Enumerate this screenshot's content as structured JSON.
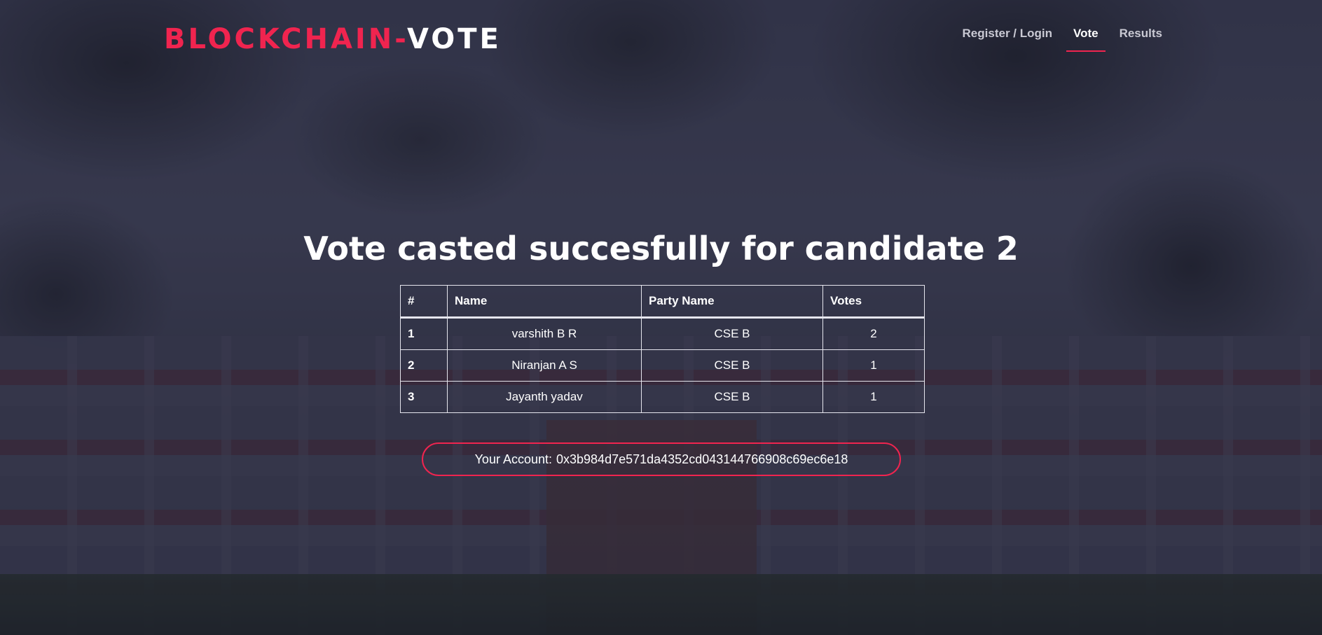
{
  "header": {
    "brand_accent": "BLOCKCHAIN-",
    "brand_rest": "VOTE",
    "nav": [
      {
        "label": "Register / Login",
        "active": false
      },
      {
        "label": "Vote",
        "active": true
      },
      {
        "label": "Results",
        "active": false
      }
    ]
  },
  "main": {
    "headline": "Vote casted succesfully for candidate 2",
    "table": {
      "columns": [
        "#",
        "Name",
        "Party Name",
        "Votes"
      ],
      "rows": [
        {
          "id": "1",
          "name": "varshith B R",
          "party": "CSE B",
          "votes": "2"
        },
        {
          "id": "2",
          "name": "Niranjan A S",
          "party": "CSE B",
          "votes": "1"
        },
        {
          "id": "3",
          "name": "Jayanth yadav",
          "party": "CSE B",
          "votes": "1"
        }
      ]
    },
    "account": {
      "label": "Your Account:",
      "address": "0x3b984d7e571da4352cd043144766908c69ec6e18"
    }
  },
  "colors": {
    "accent": "#f0244f",
    "text": "#ffffff",
    "overlay": "#1e1e30"
  }
}
